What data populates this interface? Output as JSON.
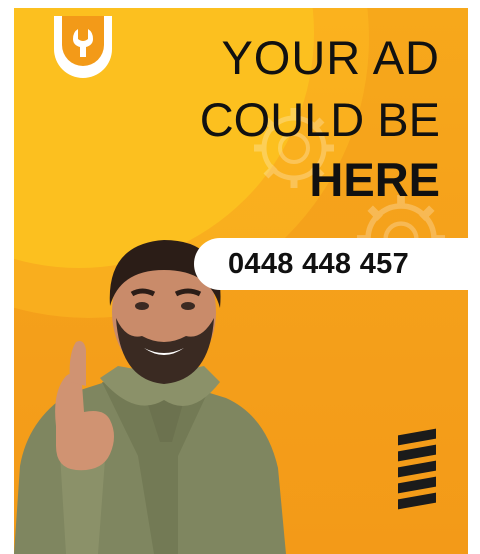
{
  "ad": {
    "headline_line1": "YOUR AD",
    "headline_line2": "COULD BE",
    "headline_line3": "HERE",
    "phone": "0448 448 457"
  },
  "colors": {
    "background_orange": "#f5a11b",
    "accent_yellow": "#f8c31d",
    "text": "#111111",
    "pill": "#ffffff"
  },
  "icons": {
    "logo": "wrench-icon",
    "decoration": "gear-icon",
    "stripes": "stripes-icon"
  }
}
